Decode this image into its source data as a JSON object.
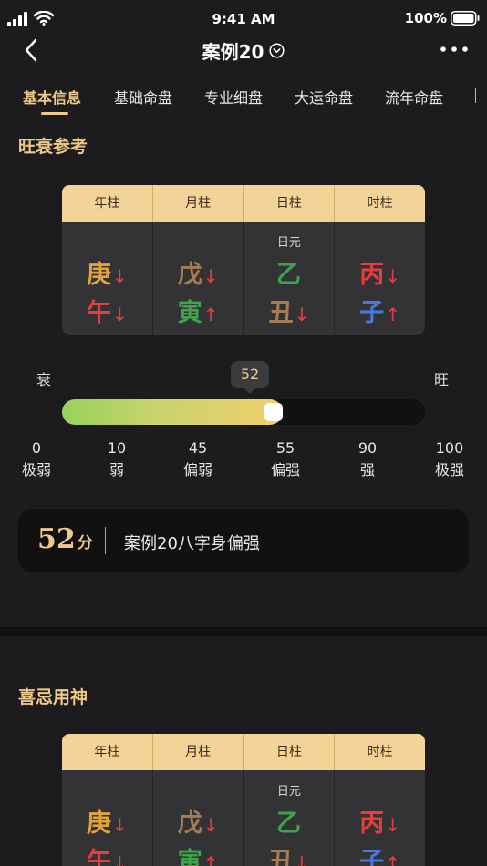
{
  "status_bar": {
    "time": "9:41 AM",
    "battery": "100%"
  },
  "nav": {
    "title": "案例20"
  },
  "tabs": [
    {
      "label": "基本信息",
      "active": true
    },
    {
      "label": "基础命盘",
      "active": false
    },
    {
      "label": "专业细盘",
      "active": false
    },
    {
      "label": "大运命盘",
      "active": false
    },
    {
      "label": "流年命盘",
      "active": false
    }
  ],
  "section1": {
    "title": "旺衰参考",
    "pillars": {
      "headers": [
        "年柱",
        "月柱",
        "日柱",
        "时柱"
      ],
      "day_master_label": "日元",
      "columns": [
        {
          "stem": "庚",
          "stem_arrow": "↓",
          "stem_color": "#e0a33e",
          "branch": "午",
          "branch_arrow": "↓",
          "branch_color": "#e63d3d"
        },
        {
          "stem": "戊",
          "stem_arrow": "↓",
          "stem_color": "#a67c52",
          "branch": "寅",
          "branch_arrow": "↑",
          "branch_color": "#3fa34d"
        },
        {
          "stem": "乙",
          "stem_arrow": "",
          "stem_color": "#3fa34d",
          "branch": "丑",
          "branch_arrow": "↓",
          "branch_color": "#a67c52"
        },
        {
          "stem": "丙",
          "stem_arrow": "↓",
          "stem_color": "#e63d3d",
          "branch": "子",
          "branch_arrow": "↑",
          "branch_color": "#4a78e0"
        }
      ]
    },
    "strength": {
      "left_label": "衰",
      "right_label": "旺",
      "value": 52,
      "value_label": "52",
      "scale": [
        {
          "num": "0",
          "text": "极弱"
        },
        {
          "num": "10",
          "text": "弱"
        },
        {
          "num": "45",
          "text": "偏弱"
        },
        {
          "num": "55",
          "text": "偏强"
        },
        {
          "num": "90",
          "text": "强"
        },
        {
          "num": "100",
          "text": "极强"
        }
      ]
    },
    "score": {
      "number": "52",
      "unit": "分",
      "summary": "案例20八字身偏强"
    }
  },
  "section2": {
    "title": "喜忌用神",
    "pillars": {
      "headers": [
        "年柱",
        "月柱",
        "日柱",
        "时柱"
      ],
      "day_master_label": "日元",
      "columns": [
        {
          "stem": "庚",
          "stem_arrow": "↓",
          "stem_color": "#e0a33e",
          "branch": "午",
          "branch_arrow": "↓",
          "branch_color": "#e63d3d"
        },
        {
          "stem": "戊",
          "stem_arrow": "↓",
          "stem_color": "#a67c52",
          "branch": "寅",
          "branch_arrow": "↑",
          "branch_color": "#3fa34d"
        },
        {
          "stem": "乙",
          "stem_arrow": "",
          "stem_color": "#3fa34d",
          "branch": "丑",
          "branch_arrow": "↓",
          "branch_color": "#a67c52"
        },
        {
          "stem": "丙",
          "stem_arrow": "↓",
          "stem_color": "#e63d3d",
          "branch": "子",
          "branch_arrow": "↑",
          "branch_color": "#4a78e0"
        }
      ]
    }
  },
  "colors": {
    "accent": "#f0c98a",
    "header_bg": "#f4d398",
    "background": "#1c1c1e"
  }
}
